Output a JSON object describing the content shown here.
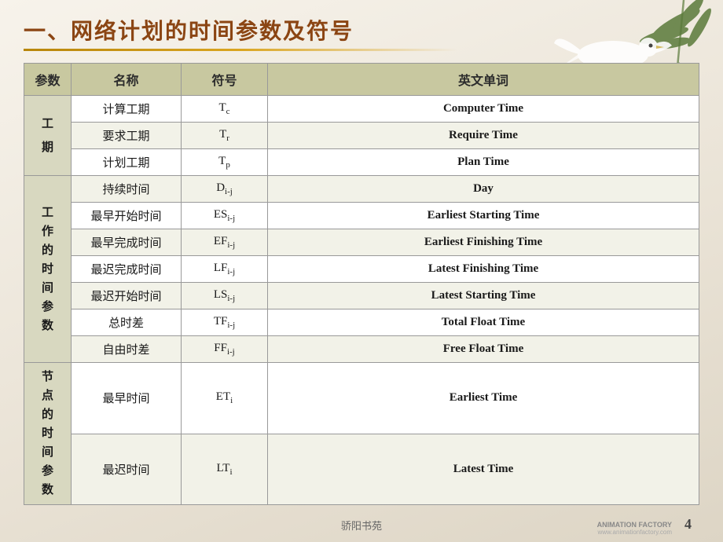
{
  "slide": {
    "title": "一、网络计划的时间参数及符号",
    "footer": "骄阳书苑",
    "page_number": "4",
    "animation_logo": "ANIMATION FACTORY\nwww.animationfactory.com"
  },
  "table": {
    "headers": [
      "参数",
      "名称",
      "符号",
      "英文单词"
    ],
    "groups": [
      {
        "group_label": "工\n期",
        "rows": [
          {
            "name": "计算工期",
            "symbol_html": "T<sub>c</sub>",
            "english": "Computer Time"
          },
          {
            "name": "要求工期",
            "symbol_html": "T<sub>r</sub>",
            "english": "Require Time"
          },
          {
            "name": "计划工期",
            "symbol_html": "T<sub>p</sub>",
            "english": "Plan Time"
          }
        ]
      },
      {
        "group_label": "工\n作\n的\n时\n间\n参\n数",
        "rows": [
          {
            "name": "持续时间",
            "symbol_html": "D<sub>i-j</sub>",
            "english": "Day"
          },
          {
            "name": "最早开始时间",
            "symbol_html": "ES<sub>i-j</sub>",
            "english": "Earliest Starting Time"
          },
          {
            "name": "最早完成时间",
            "symbol_html": "EF<sub>i-j</sub>",
            "english": "Earliest Finishing Time"
          },
          {
            "name": "最迟完成时间",
            "symbol_html": "LF<sub>i-j</sub>",
            "english": "Latest Finishing Time"
          },
          {
            "name": "最迟开始时间",
            "symbol_html": "LS<sub>i-j</sub>",
            "english": "Latest Starting Time"
          },
          {
            "name": "总时差",
            "symbol_html": "TF<sub>i-j</sub>",
            "english": "Total Float Time"
          },
          {
            "name": "自由时差",
            "symbol_html": "FF<sub>i-j</sub>",
            "english": "Free Float Time"
          }
        ]
      },
      {
        "group_label": "节\n点\n的\n时\n间\n参\n数",
        "rows": [
          {
            "name": "最早时间",
            "symbol_html": "ET<sub>i</sub>",
            "english": "Earliest Time"
          },
          {
            "name": "最迟时间",
            "symbol_html": "LT<sub>i</sub>",
            "english": "Latest Time"
          }
        ]
      }
    ]
  }
}
